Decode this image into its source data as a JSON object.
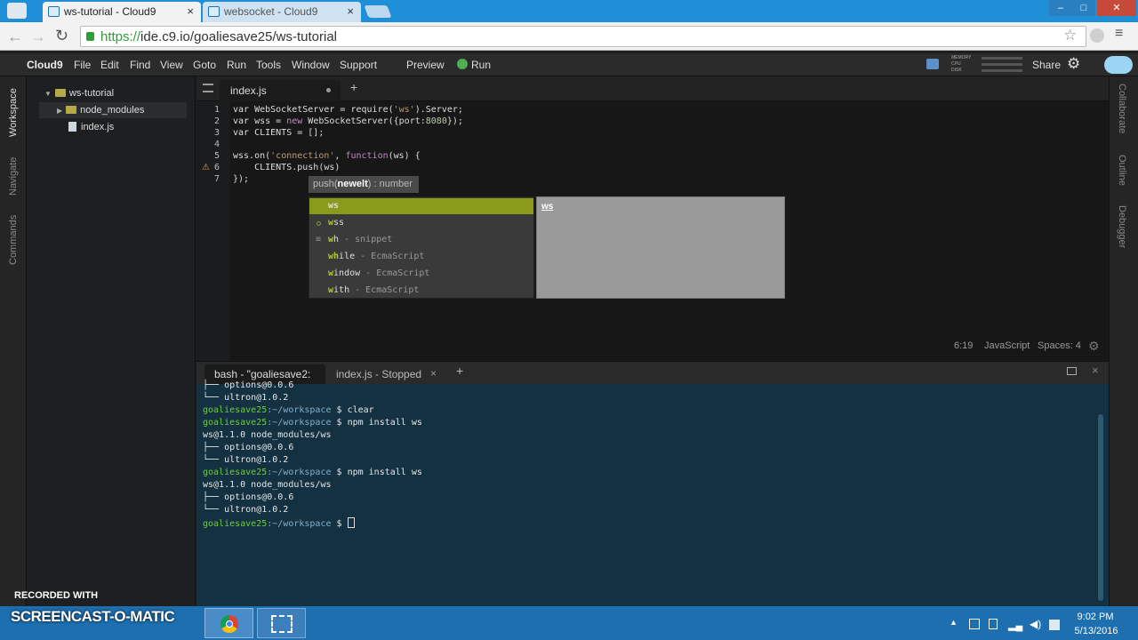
{
  "browser": {
    "tabs": [
      {
        "label": "ws-tutorial - Cloud9",
        "active": true
      },
      {
        "label": "websocket - Cloud9",
        "active": false
      }
    ],
    "url_scheme": "https://",
    "url_rest": "ide.c9.io/goaliesave25/ws-tutorial"
  },
  "ide": {
    "brand": "Cloud9",
    "menu": [
      "File",
      "Edit",
      "Find",
      "View",
      "Goto",
      "Run",
      "Tools",
      "Window",
      "Support"
    ],
    "preview_label": "Preview",
    "run_label": "Run",
    "meters": [
      "MEMORY",
      "CPU",
      "DISK"
    ],
    "share_label": "Share",
    "left_rail": [
      "Workspace",
      "Navigate",
      "Commands"
    ],
    "right_rail": [
      "Collaborate",
      "Outline",
      "Debugger"
    ]
  },
  "tree": {
    "root": "ws-tutorial",
    "items": [
      "node_modules",
      "index.js"
    ]
  },
  "editor": {
    "tab_label": "index.js",
    "line_numbers": [
      "1",
      "2",
      "3",
      "4",
      "5",
      "6",
      "7"
    ],
    "tooltip_pre": "push(",
    "tooltip_bold": "newelt",
    "tooltip_post": ") : number",
    "autocomplete": [
      {
        "prefix": "",
        "match": "ws",
        "rest": "",
        "hint": ""
      },
      {
        "prefix": "",
        "match": "w",
        "rest": "ss",
        "hint": ""
      },
      {
        "prefix": "",
        "match": "w",
        "rest": "h",
        "hint": "- snippet"
      },
      {
        "prefix": "",
        "match": "wh",
        "rest": "ile",
        "hint": "- EcmaScript"
      },
      {
        "prefix": "",
        "match": "w",
        "rest": "indow",
        "hint": "- EcmaScript"
      },
      {
        "prefix": "",
        "match": "w",
        "rest": "ith",
        "hint": "- EcmaScript"
      }
    ],
    "doc_title": "ws",
    "status": {
      "position": "6:19",
      "language": "JavaScript",
      "spaces": "Spaces: 4"
    }
  },
  "terminal": {
    "tabs": [
      "bash - \"goaliesave2:",
      "index.js - Stopped"
    ],
    "prompt_user": "goaliesave25",
    "prompt_path": ":~/workspace",
    "prompt_symbol": "$",
    "lines": [
      {
        "kind": "out",
        "text": "├── options@0.0.6"
      },
      {
        "kind": "out",
        "text": "└── ultron@1.0.2"
      },
      {
        "kind": "cmd",
        "text": " clear"
      },
      {
        "kind": "cmd",
        "text": " npm install ws"
      },
      {
        "kind": "out",
        "text": "ws@1.1.0 node_modules/ws"
      },
      {
        "kind": "out",
        "text": "├── options@0.0.6"
      },
      {
        "kind": "out",
        "text": "└── ultron@1.0.2"
      },
      {
        "kind": "cmd",
        "text": " npm install ws"
      },
      {
        "kind": "out",
        "text": "ws@1.1.0 node_modules/ws"
      },
      {
        "kind": "out",
        "text": "├── options@0.0.6"
      },
      {
        "kind": "out",
        "text": "└── ultron@1.0.2"
      },
      {
        "kind": "cmd",
        "text": " "
      }
    ]
  },
  "watermark": {
    "top": "RECORDED WITH",
    "bottom": "SCREENCAST-O-MATIC"
  },
  "clock": {
    "time": "9:02 PM",
    "date": "5/13/2016"
  }
}
